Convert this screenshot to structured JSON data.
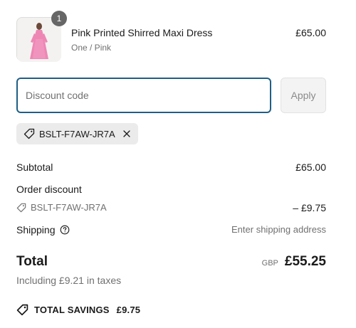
{
  "product": {
    "quantity": "1",
    "name": "Pink Printed Shirred Maxi Dress",
    "variant": "One / Pink",
    "price": "£65.00"
  },
  "discount": {
    "placeholder": "Discount code",
    "apply_label": "Apply",
    "applied_code": "BSLT-F7AW-JR7A"
  },
  "summary": {
    "subtotal_label": "Subtotal",
    "subtotal_value": "£65.00",
    "order_discount_label": "Order discount",
    "order_discount_code": "BSLT-F7AW-JR7A",
    "order_discount_value": "– £9.75",
    "shipping_label": "Shipping",
    "shipping_value": "Enter shipping address",
    "total_label": "Total",
    "currency": "GBP",
    "total_value": "£55.25",
    "taxes_note": "Including £9.21 in taxes",
    "savings_label": "TOTAL SAVINGS",
    "savings_value": "£9.75"
  },
  "colors": {
    "input_focus_border": "#1f5f85",
    "muted_text": "#707070",
    "chip_background": "#ebebeb",
    "badge_background": "#666666"
  }
}
